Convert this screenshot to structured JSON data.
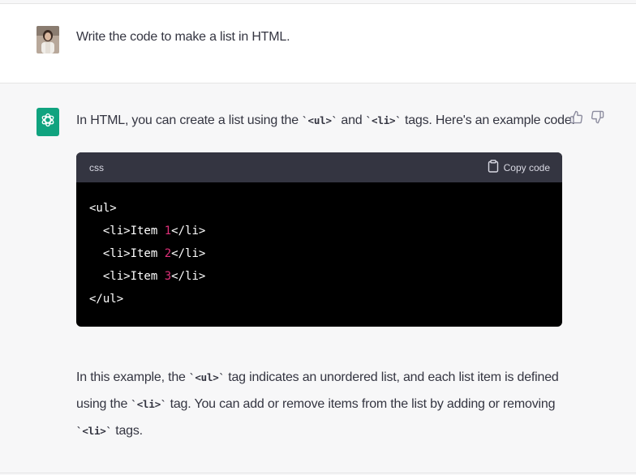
{
  "user_message": {
    "text": "Write the code to make a list in HTML."
  },
  "assistant_message": {
    "intro_before": "In HTML, you can create a list using the ",
    "intro_code1": "`<ul>`",
    "intro_and": " and ",
    "intro_code2": "`<li>`",
    "intro_after": " tags. Here's an example code:",
    "code_block": {
      "language": "css",
      "copy_label": "Copy code",
      "lines": [
        {
          "pre": "<ul>",
          "num": "",
          "post": ""
        },
        {
          "pre": "  <li>Item ",
          "num": "1",
          "post": "</li>"
        },
        {
          "pre": "  <li>Item ",
          "num": "2",
          "post": "</li>"
        },
        {
          "pre": "  <li>Item ",
          "num": "3",
          "post": "</li>"
        },
        {
          "pre": "</ul>",
          "num": "",
          "post": ""
        }
      ]
    },
    "para_1": "In this example, the ",
    "para_code1": "`<ul>`",
    "para_2": " tag indicates an unordered list, and each list item is defined using the ",
    "para_code2": "`<li>`",
    "para_3": " tag. You can add or remove items from the list by adding or removing ",
    "para_code3": "`<li>`",
    "para_4": " tags."
  },
  "icons": {
    "assistant_avatar": "openai-logo-icon",
    "thumbs_up": "thumbs-up-icon",
    "thumbs_down": "thumbs-down-icon",
    "copy": "clipboard-icon"
  },
  "colors": {
    "assistant_avatar_bg": "#10a37f",
    "code_bg": "#000000",
    "code_header_bg": "#343541",
    "number_literal": "#df3079"
  }
}
